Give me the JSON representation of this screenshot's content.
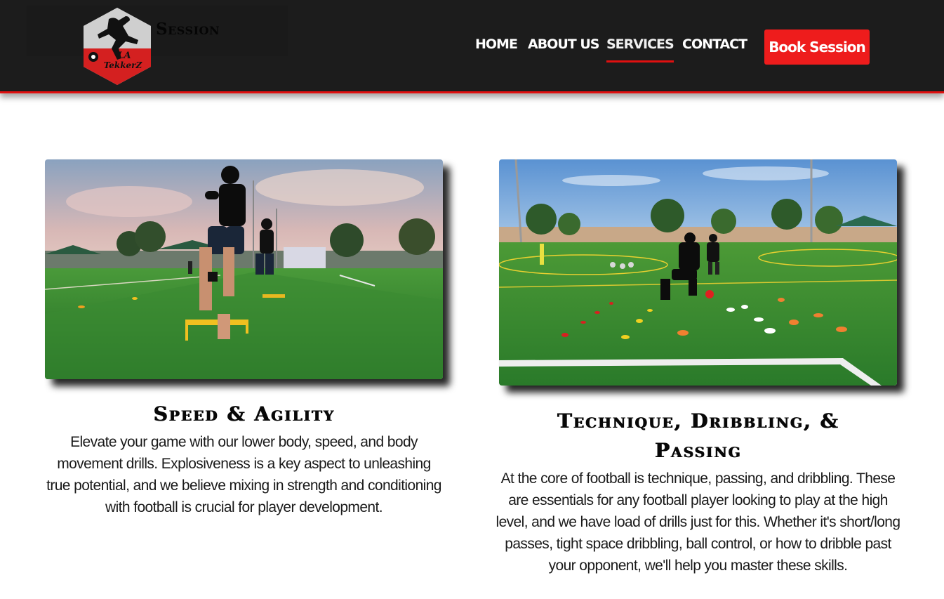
{
  "header": {
    "logo_badge_line1": "LA",
    "logo_badge_line2": "TekkerZ",
    "logo_text": "Session",
    "nav": [
      {
        "label": "HOME"
      },
      {
        "label": "ABOUT US"
      },
      {
        "label": "SERVICES",
        "active": true
      },
      {
        "label": "CONTACT"
      }
    ],
    "cta_label": "Book Session",
    "accent_color": "#e01010"
  },
  "services": [
    {
      "title": "Speed & Agility",
      "description": "Elevate your game with our lower body, speed, and body movement drills. Explosiveness is a key aspect to unleashing true potential, and we believe mixing in strength and conditioning with football is crucial for player development."
    },
    {
      "title": "Technique, Dribbling, & Passing",
      "description": "At the core of football is technique, passing, and dribbling. These are essentials for any football player looking to play at the high level, and we have load of drills just for this. Whether it's short/long passes, tight space dribbling, ball control, or how to dribble past your opponent, we'll help you master these skills."
    }
  ]
}
